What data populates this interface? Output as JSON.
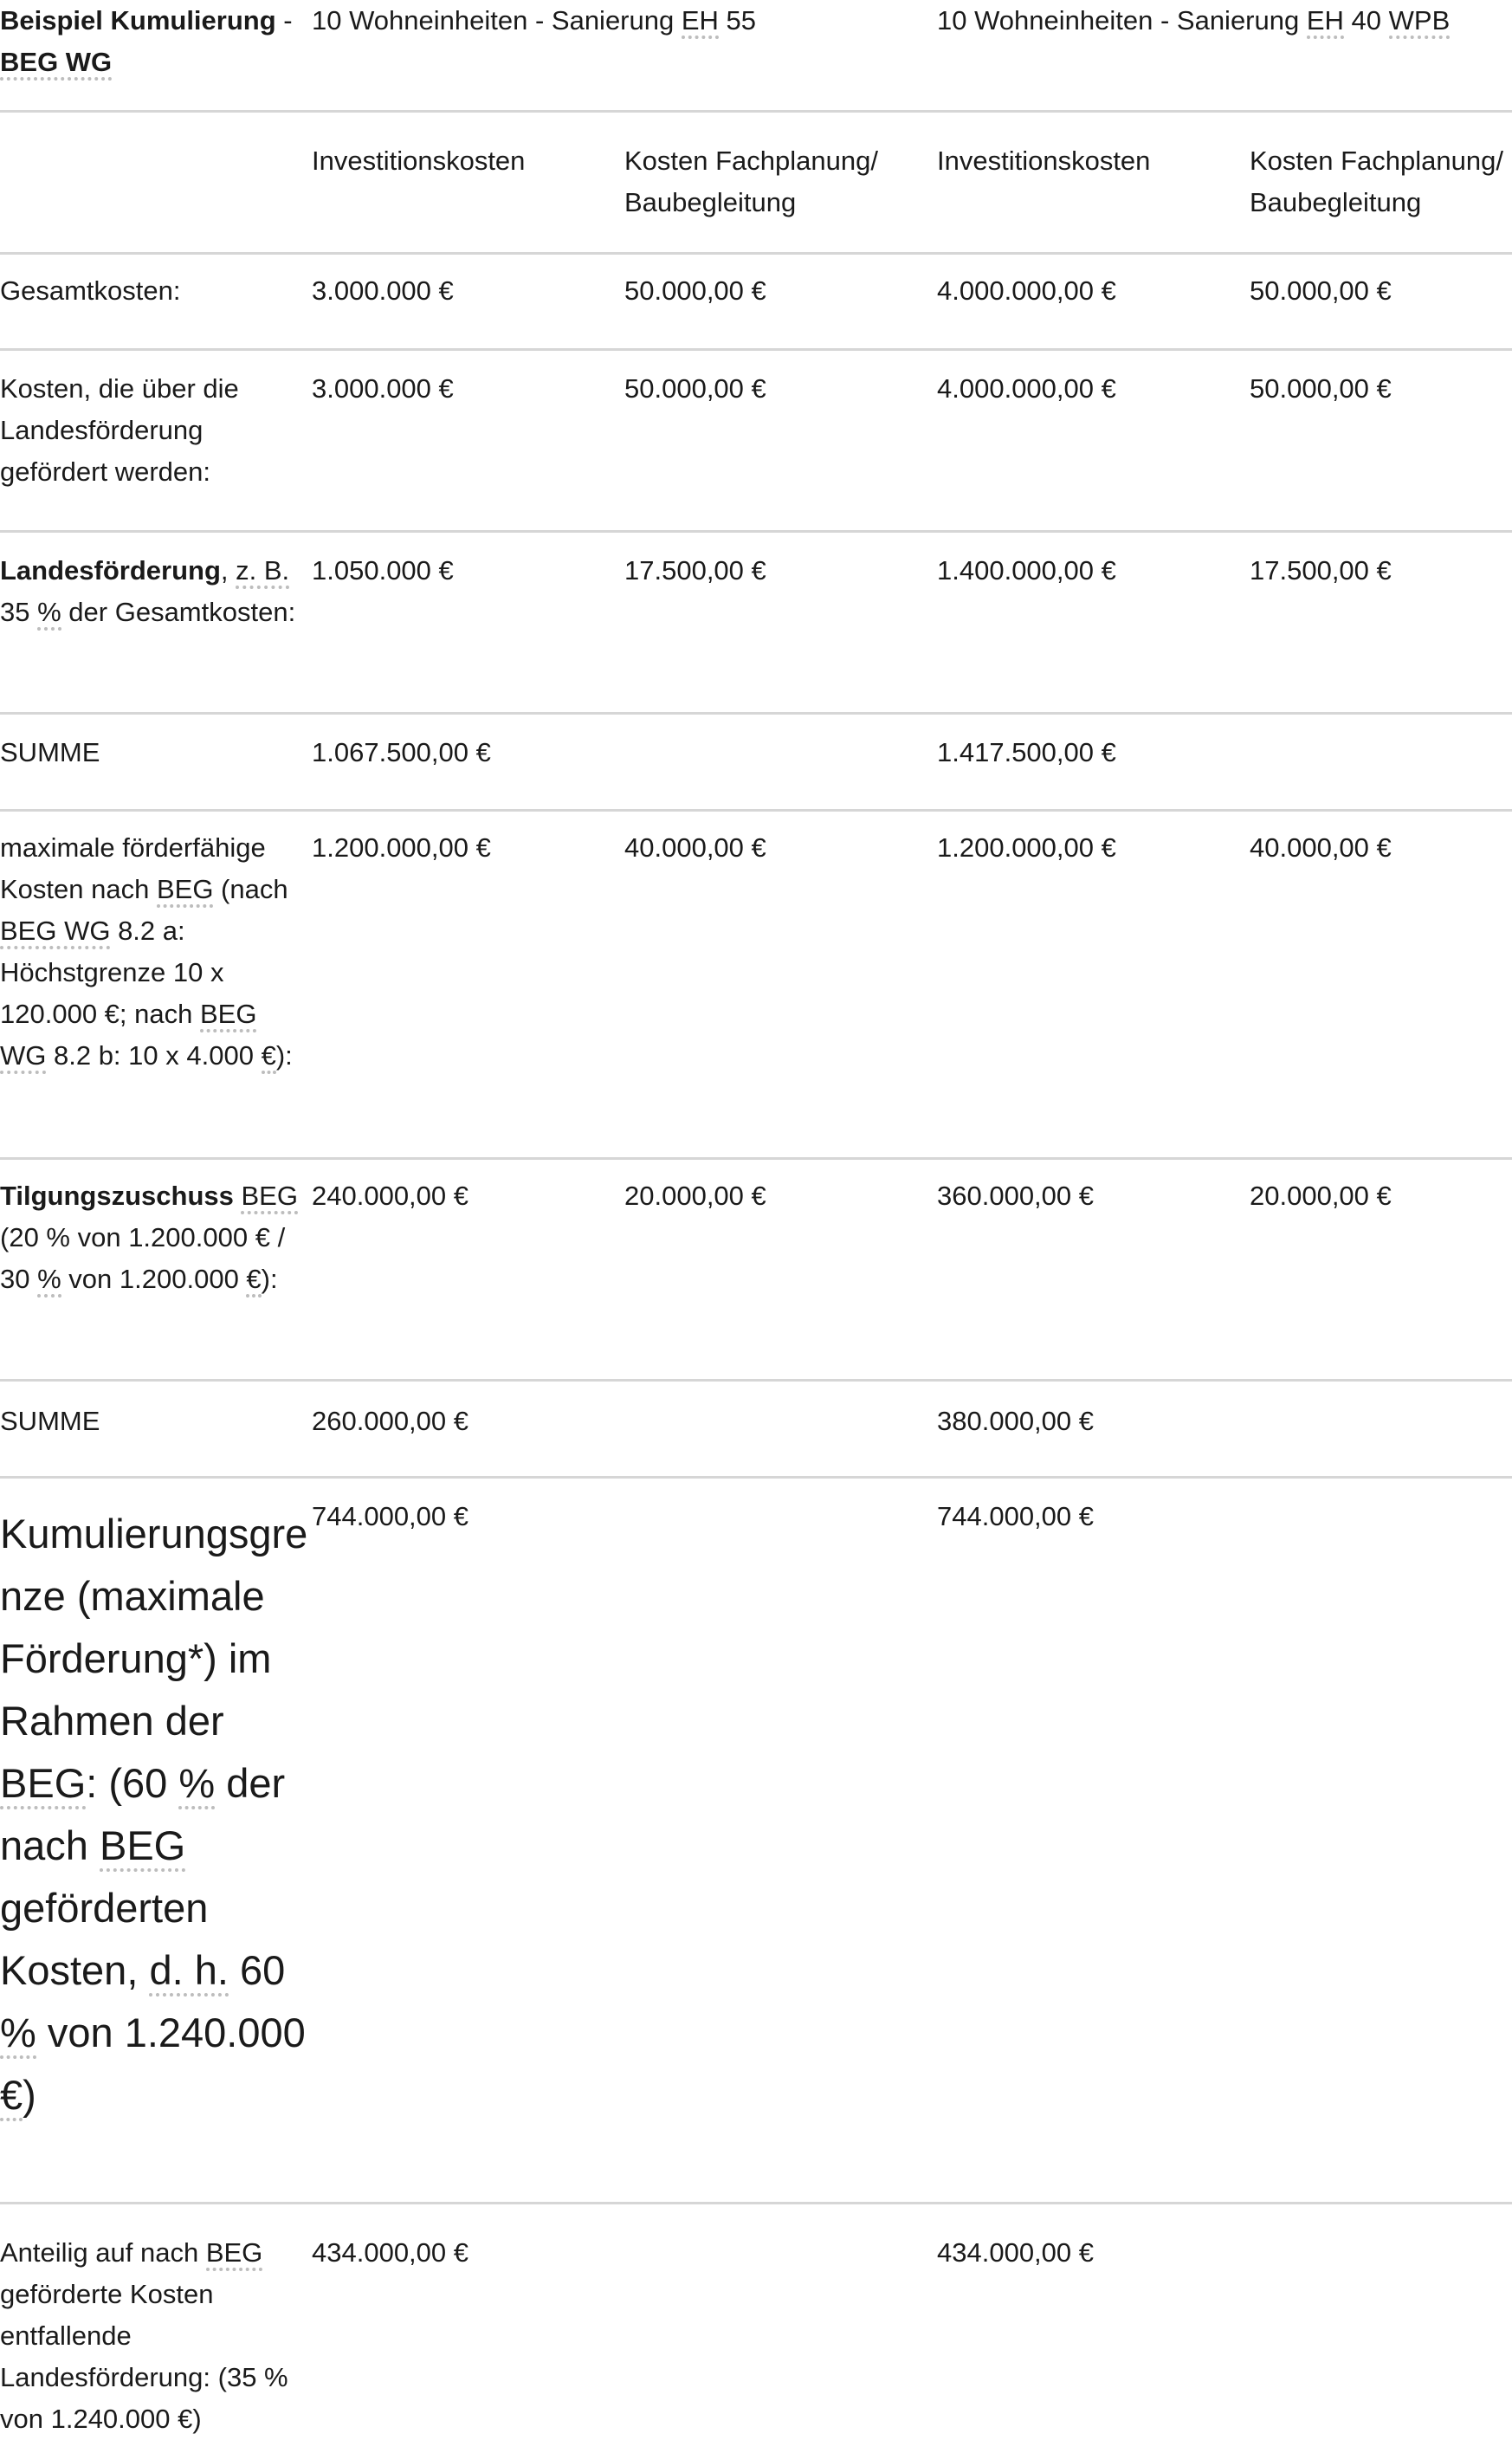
{
  "table": {
    "corner": {
      "bold": "Beispiel Kumulierung",
      "dash": " - ",
      "abbr": "BEG WG"
    },
    "scenarios": [
      {
        "prefix": "10 Wohneinheiten - Sanierung ",
        "abbr1": "EH",
        "middle": " 55",
        "abbr2": "",
        "suffix": ""
      },
      {
        "prefix": "10 Wohneinheiten - Sanierung ",
        "abbr1": "EH",
        "middle": " 40 ",
        "abbr2": "WPB",
        "suffix": ""
      }
    ],
    "subheaders": [
      "Investitionskosten",
      "Kosten Fachplanung/ Baubegleitung",
      "Investitionskosten",
      "Kosten Fachplanung/ Baubegleitung"
    ],
    "rows": {
      "gesamtkosten": {
        "label": "Gesamtkosten:",
        "values": [
          "3.000.000 €",
          "50.000,00 €",
          "4.000.000,00 €",
          "50.000,00 €"
        ]
      },
      "landes_kosten": {
        "label": "Kosten, die über die Landesförderung gefördert werden:",
        "values": [
          "3.000.000 €",
          "50.000,00 €",
          "4.000.000,00 €",
          "50.000,00 €"
        ]
      },
      "landesfoerderung": {
        "label_bold": "Landesförderung",
        "label_a": ", ",
        "abbr_zb": "z. B.",
        "label_b": " 35 ",
        "abbr_pct": "%",
        "label_c": " der Gesamtkosten:",
        "values": [
          "1.050.000 €",
          "17.500,00 €",
          "1.400.000,00 €",
          "17.500,00 €"
        ]
      },
      "summe1": {
        "label": "SUMME",
        "values": [
          "1.067.500,00 €",
          "",
          "1.417.500,00 €",
          ""
        ]
      },
      "max_foerderfaehig": {
        "t1": "maximale förderfähige Kosten nach ",
        "a1": "BEG",
        "t2": " (nach ",
        "a2": "BEG WG",
        "t3": " 8.2 a: Höchstgrenze 10 x 120.000 €; nach ",
        "a3": "BEG",
        "t4": " ",
        "a4": "WG",
        "t5": " 8.2 b: 10 x 4.000 ",
        "a5": "€",
        "t6": "):",
        "values": [
          "1.200.000,00 €",
          "40.000,00 €",
          "1.200.000,00 €",
          "40.000,00 €"
        ]
      },
      "tilgungszuschuss": {
        "bold": "Tilgungszuschuss",
        "t1": " ",
        "a1": "BEG",
        "t2": " (20 % von 1.200.000 € / 30 ",
        "a2": "%",
        "t3": " von 1.200.000 ",
        "a3": "€",
        "t4": "):",
        "values": [
          "240.000,00 €",
          "20.000,00 €",
          "360.000,00 €",
          "20.000,00 €"
        ]
      },
      "summe2": {
        "label": "SUMME",
        "values": [
          "260.000,00 €",
          "",
          "380.000,00 €",
          ""
        ]
      },
      "kumulierungsgrenze": {
        "t1": "Kumulierungsgrenze (maximale Förderung*) im Rahmen der ",
        "a1": "BEG",
        "t2": ": (60 ",
        "a2": "%",
        "t3": " der nach ",
        "a3": "BEG",
        "t4": " geförderten Kosten, ",
        "a4": "d. h.",
        "t5": " 60 ",
        "a5": "%",
        "t6": " von 1.240.000 ",
        "a6": "€",
        "t7": ")",
        "values": [
          "744.000,00 €",
          "",
          "744.000,00 €",
          ""
        ]
      },
      "anteilig": {
        "t1": "Anteilig auf nach ",
        "a1": "BEG",
        "t2": " geförderte Kosten entfallende Landesförderung: (35 % von 1.240.000 €)",
        "values": [
          "434.000,00 €",
          "",
          "434.000,00 €",
          ""
        ]
      }
    }
  }
}
